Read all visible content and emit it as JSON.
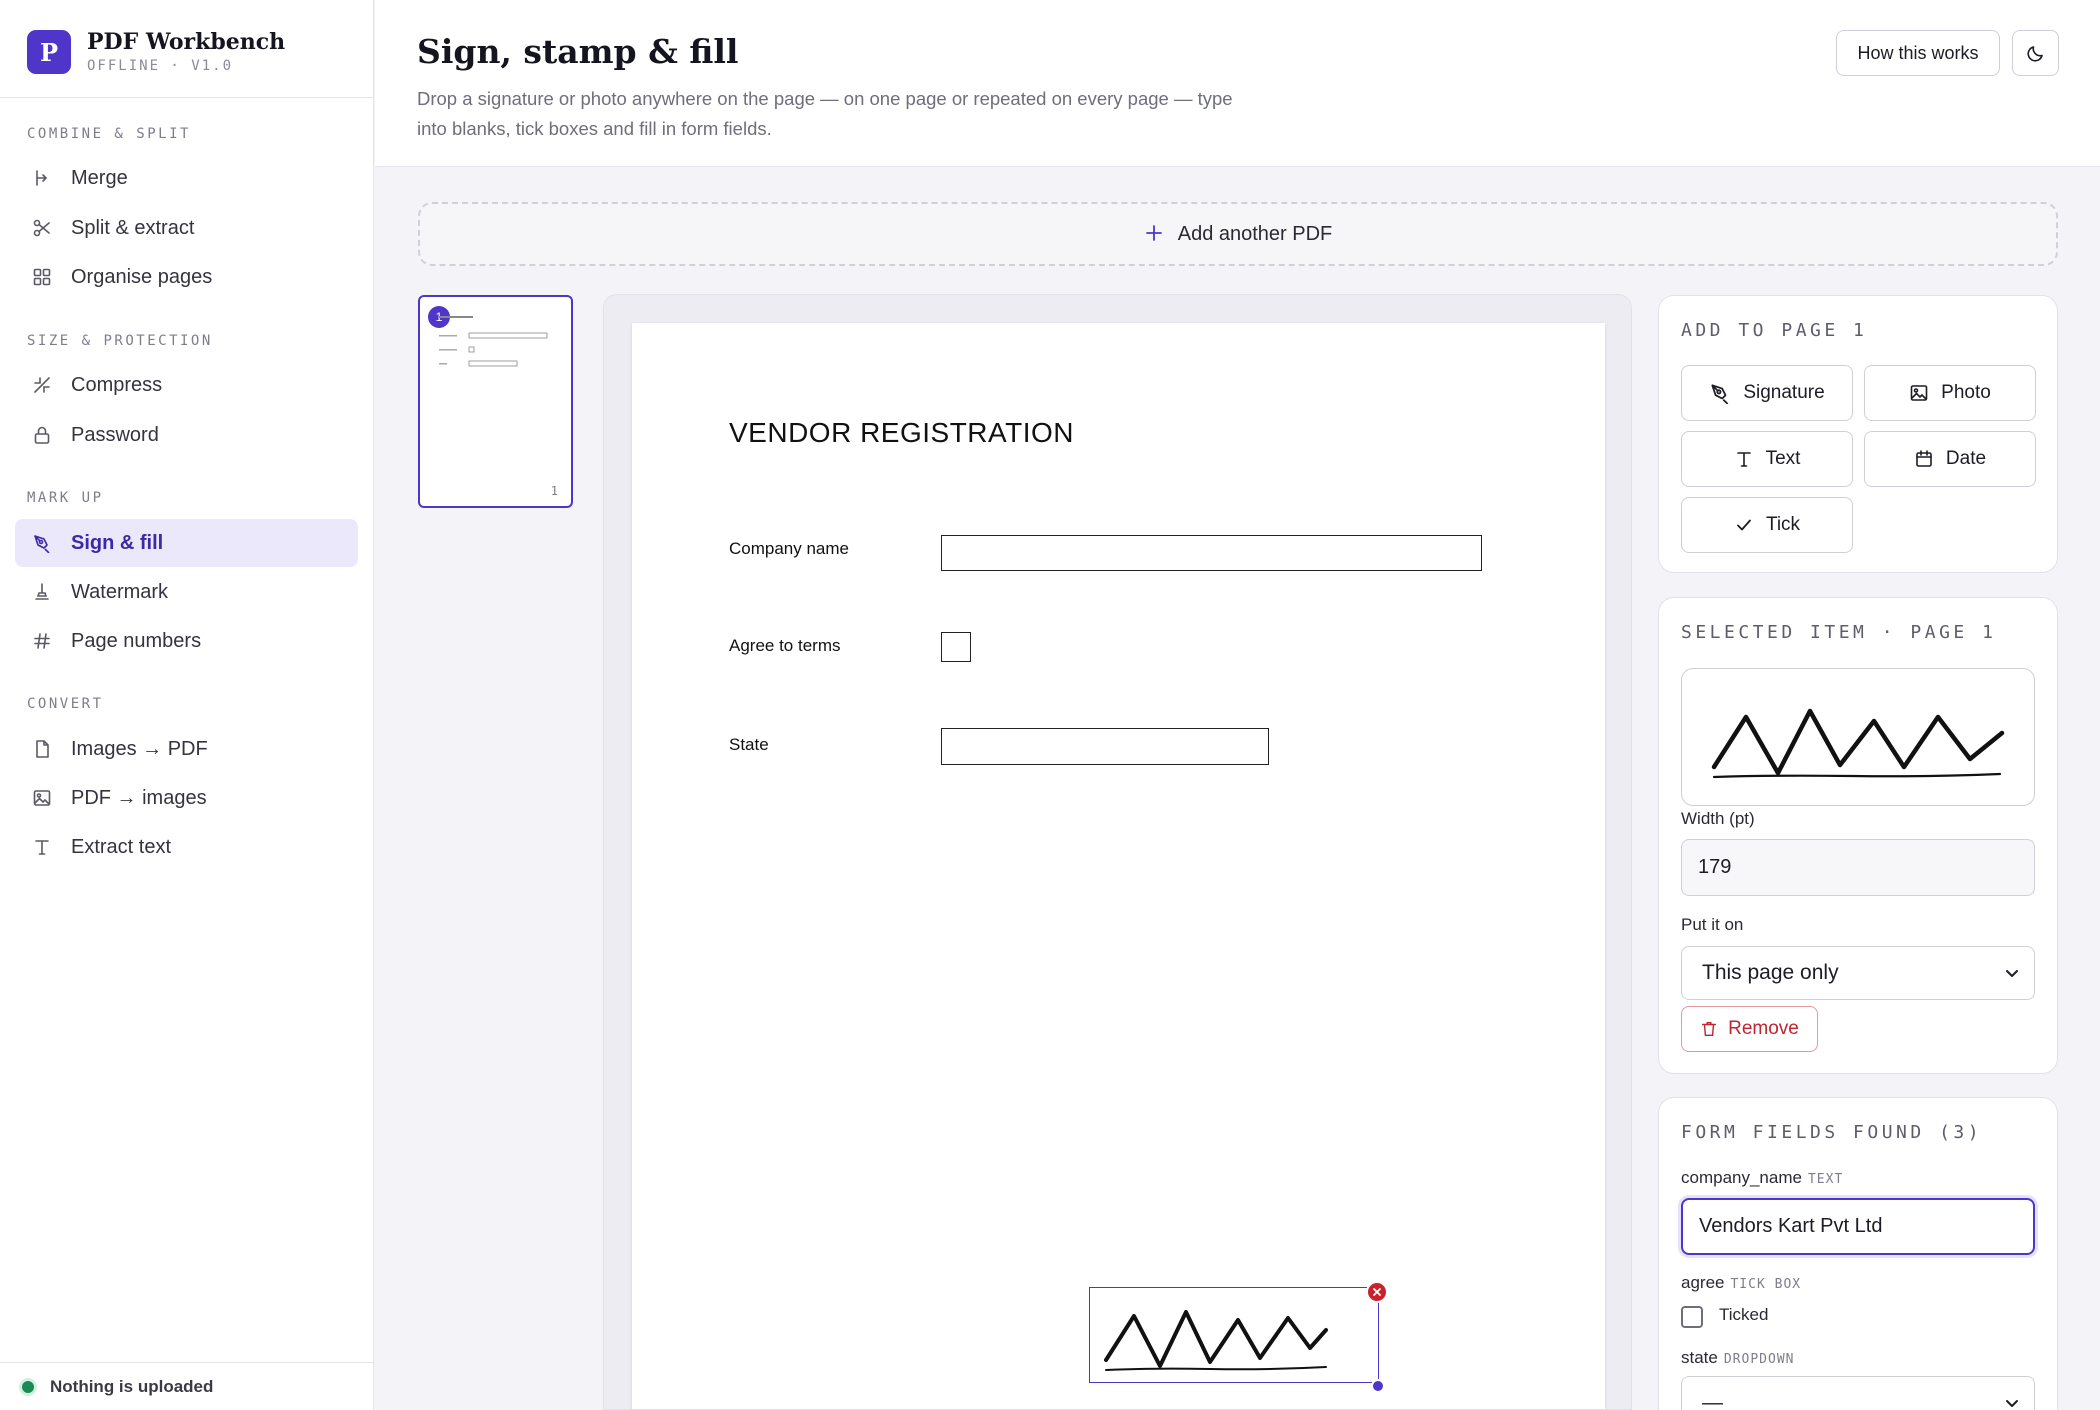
{
  "app": {
    "name": "PDF Workbench",
    "subtitle": "OFFLINE · V1.0",
    "logo_letter": "P",
    "brand_color": "#4f35c9"
  },
  "sidebar": {
    "groups": [
      {
        "label": "COMBINE & SPLIT",
        "items": [
          {
            "label": "Merge",
            "icon": "merge-icon"
          },
          {
            "label": "Split & extract",
            "icon": "scissors-icon"
          },
          {
            "label": "Organise pages",
            "icon": "grid-icon"
          }
        ]
      },
      {
        "label": "SIZE & PROTECTION",
        "items": [
          {
            "label": "Compress",
            "icon": "compress-icon"
          },
          {
            "label": "Password",
            "icon": "lock-icon"
          }
        ]
      },
      {
        "label": "MARK UP",
        "items": [
          {
            "label": "Sign & fill",
            "icon": "pen-icon",
            "active": true
          },
          {
            "label": "Watermark",
            "icon": "stamp-icon"
          },
          {
            "label": "Page numbers",
            "icon": "hash-icon"
          }
        ]
      },
      {
        "label": "CONVERT",
        "items": [
          {
            "label": "Images → PDF",
            "icon": "file-icon"
          },
          {
            "label": "PDF → images",
            "icon": "image-icon"
          },
          {
            "label": "Extract text",
            "icon": "text-icon"
          }
        ]
      }
    ],
    "status": "Nothing is uploaded",
    "status_color": "#1c8a55"
  },
  "header": {
    "title": "Sign, stamp & fill",
    "description": "Drop a signature or photo anywhere on the page — on one page or repeated on every page — type into blanks, tick boxes and fill in form fields.",
    "help_button": "How this works",
    "theme_toggle_icon": "moon-icon"
  },
  "upload": {
    "add_label": "Add another PDF"
  },
  "thumbnails": [
    {
      "badge": "1",
      "page_number": "1"
    }
  ],
  "document": {
    "title": "VENDOR REGISTRATION",
    "fields": [
      {
        "label": "Company name"
      },
      {
        "label": "Agree to terms"
      },
      {
        "label": "State"
      }
    ]
  },
  "add_panel": {
    "title": "ADD TO PAGE 1",
    "tools": [
      {
        "label": "Signature",
        "icon": "pen-icon"
      },
      {
        "label": "Photo",
        "icon": "image-icon"
      },
      {
        "label": "Text",
        "icon": "text-icon"
      },
      {
        "label": "Date",
        "icon": "calendar-icon"
      },
      {
        "label": "Tick",
        "icon": "check-icon"
      }
    ]
  },
  "selected_panel": {
    "title": "SELECTED ITEM · PAGE 1",
    "width_label": "Width (pt)",
    "width_value": "179",
    "placement_label": "Put it on",
    "placement_value": "This page only",
    "remove_label": "Remove"
  },
  "form_panel": {
    "title": "FORM FIELDS FOUND (3)",
    "fields": [
      {
        "name": "company_name",
        "type": "TEXT",
        "value": "Vendors Kart Pvt Ltd"
      },
      {
        "name": "agree",
        "type": "TICK BOX",
        "checkbox_label": "Ticked",
        "checked": false
      },
      {
        "name": "state",
        "type": "DROPDOWN",
        "value": "—"
      }
    ]
  }
}
